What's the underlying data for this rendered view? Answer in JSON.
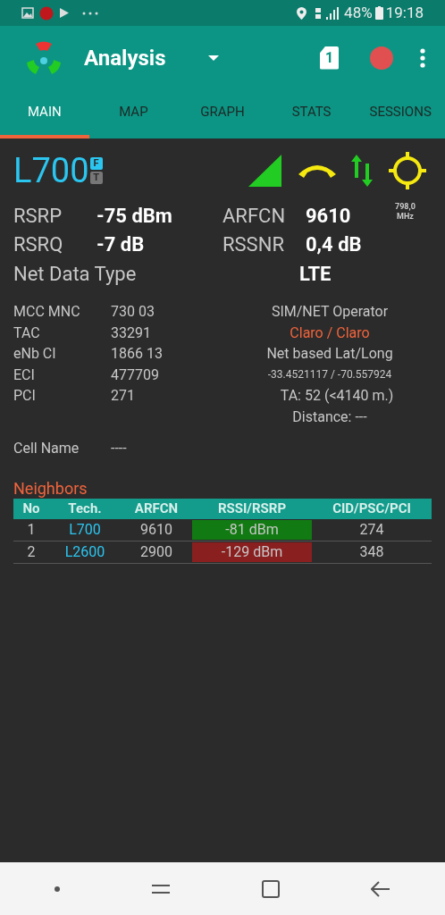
{
  "status_bar": {
    "battery": "48%",
    "time": "19:18"
  },
  "app_bar": {
    "title": "Analysis",
    "sim_number": "1"
  },
  "tabs": [
    {
      "label": "MAIN",
      "selected": true
    },
    {
      "label": "MAP",
      "selected": false
    },
    {
      "label": "GRAPH",
      "selected": false
    },
    {
      "label": "STATS",
      "selected": false
    },
    {
      "label": "SESSIONS",
      "selected": false
    }
  ],
  "cell": {
    "tech": "L700",
    "badges": [
      {
        "label": "F",
        "active": true
      },
      {
        "label": "T",
        "active": false
      }
    ]
  },
  "metrics": [
    {
      "label": "RSRP",
      "value": "-75 dBm"
    },
    {
      "label": "RSRQ",
      "value": "-7 dB"
    }
  ],
  "metrics_right": [
    {
      "label": "ARFCN",
      "value": "9610",
      "note": "798,0",
      "unit": "MHz"
    },
    {
      "label": "RSSNR",
      "value": "0,4 dB"
    }
  ],
  "net_data_type": {
    "label": "Net Data Type",
    "value": "LTE"
  },
  "info": [
    {
      "label": "MCC MNC",
      "value": "730 03"
    },
    {
      "label": "TAC",
      "value": "33291"
    },
    {
      "label": "eNb CI",
      "value": "1866 13"
    },
    {
      "label": "ECI",
      "value": "477709"
    },
    {
      "label": "PCI",
      "value": "271"
    }
  ],
  "operator": {
    "label": "SIM/NET Operator",
    "value": "Claro / Claro",
    "latlong_label": "Net based Lat/Long",
    "latlong": "-33.4521117 / -70.557924",
    "ta": "TA: 52 (<4140 m.)",
    "distance": "Distance: ---"
  },
  "cell_name": {
    "label": "Cell Name",
    "value": "----"
  },
  "neighbors": {
    "title": "Neighbors",
    "columns": [
      "No",
      "Tech.",
      "ARFCN",
      "RSSI/RSRP",
      "CID/PSC/PCI"
    ],
    "rows": [
      {
        "no": "1",
        "tech": "L700",
        "arfcn": "9610",
        "signal": "-81 dBm",
        "color": "#127a12",
        "id": "274"
      },
      {
        "no": "2",
        "tech": "L2600",
        "arfcn": "2900",
        "signal": "-129 dBm",
        "color": "#8a1f1f",
        "id": "348"
      }
    ]
  }
}
